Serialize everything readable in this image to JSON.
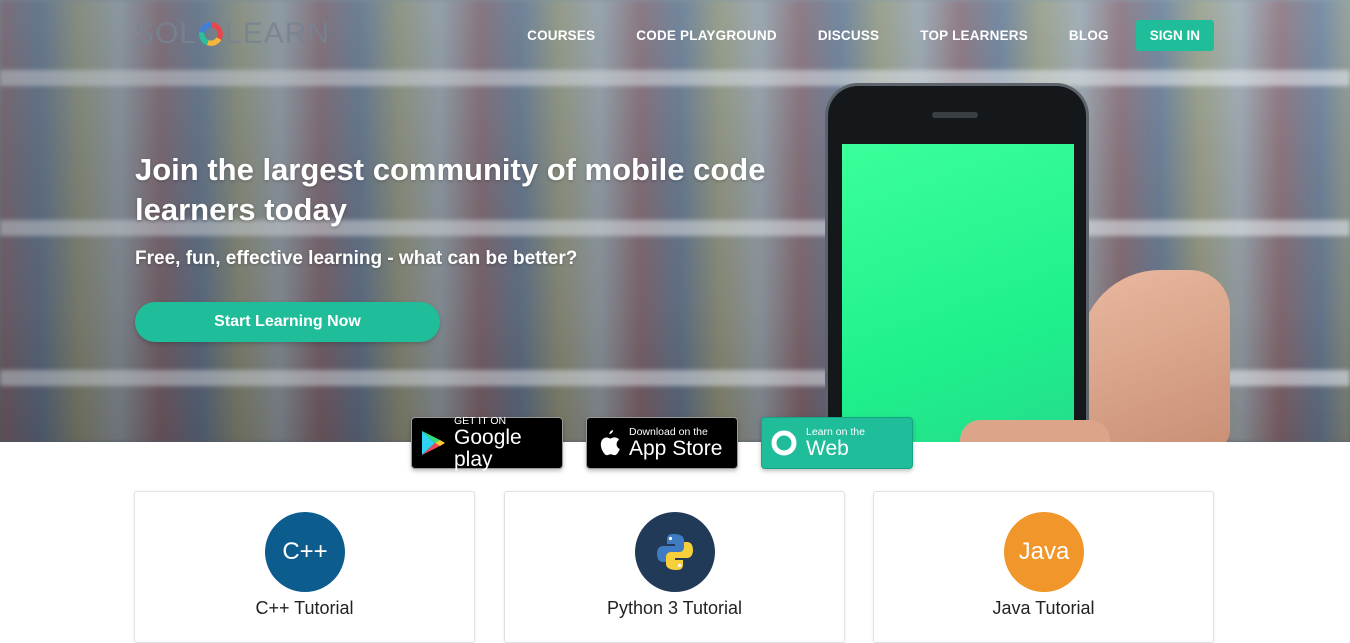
{
  "brand": {
    "name_left": "SOL",
    "name_right": "LEARN"
  },
  "nav": {
    "items": [
      "COURSES",
      "CODE PLAYGROUND",
      "DISCUSS",
      "TOP LEARNERS",
      "BLOG"
    ],
    "signin": "SIGN IN"
  },
  "hero": {
    "headline": "Join the largest community of mobile code learners today",
    "subheadline": "Free, fun, effective learning - what can be better?",
    "cta": "Start Learning Now"
  },
  "badges": {
    "google": {
      "small": "GET IT ON",
      "big": "Google play"
    },
    "apple": {
      "small": "Download on the",
      "big": "App Store"
    },
    "web": {
      "small": "Learn on the",
      "big": "Web"
    }
  },
  "courses": [
    {
      "icon_text": "C++",
      "title": "C++ Tutorial",
      "color": "#0d5c8e"
    },
    {
      "icon_text": "",
      "title": "Python 3 Tutorial",
      "color": "#203a57"
    },
    {
      "icon_text": "Java",
      "title": "Java Tutorial",
      "color": "#f0962a"
    }
  ],
  "colors": {
    "accent": "#1fbd9a"
  }
}
